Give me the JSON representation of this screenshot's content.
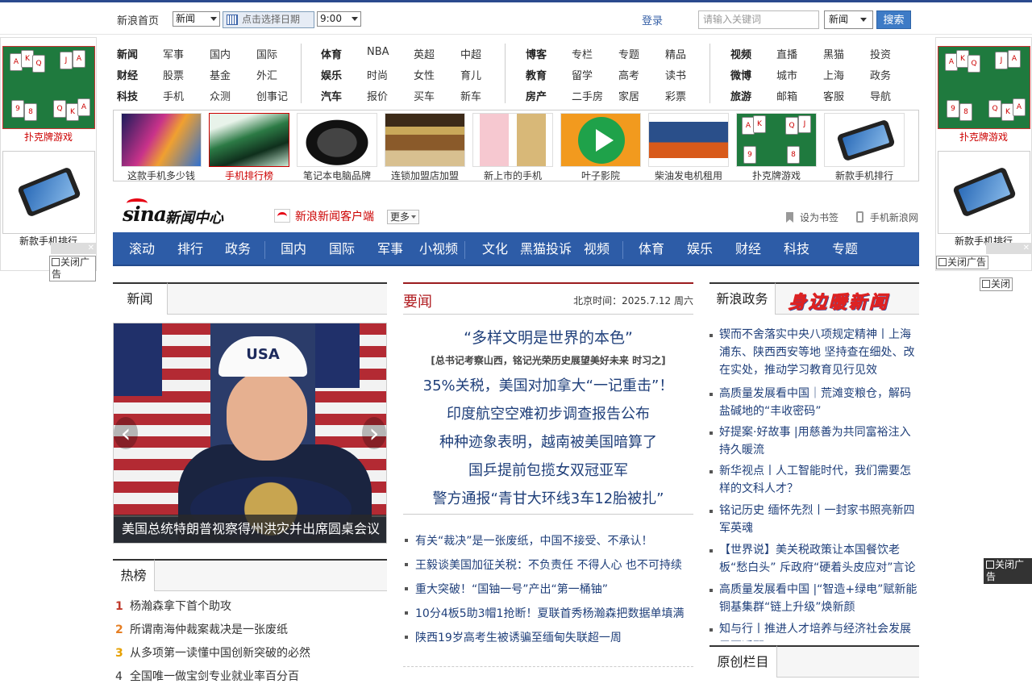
{
  "topbar": {
    "home": "新浪首页",
    "category_select": "新闻",
    "date_placeholder": "点击选择日期",
    "time_select": "9:00",
    "login": "登录",
    "search_placeholder": "请输入关键词",
    "search_scope": "新闻",
    "search_button": "搜索"
  },
  "side_ads": {
    "left_poker": "扑克牌游戏",
    "left_phone": "新款手机排行",
    "right_poker": "扑克牌游戏",
    "right_phone": "新款手机排行",
    "close_ad": "关闭广告",
    "close": "关闭"
  },
  "nav_groups": [
    {
      "rows": [
        [
          "新闻",
          "军事",
          "国内",
          "国际"
        ],
        [
          "财经",
          "股票",
          "基金",
          "外汇"
        ],
        [
          "科技",
          "手机",
          "众测",
          "创事记"
        ]
      ]
    },
    {
      "rows": [
        [
          "体育",
          "NBA",
          "英超",
          "中超"
        ],
        [
          "娱乐",
          "时尚",
          "女性",
          "育儿"
        ],
        [
          "汽车",
          "报价",
          "买车",
          "新车"
        ]
      ]
    },
    {
      "rows": [
        [
          "博客",
          "专栏",
          "专题",
          "精品"
        ],
        [
          "教育",
          "留学",
          "高考",
          "读书"
        ],
        [
          "房产",
          "二手房",
          "家居",
          "彩票"
        ]
      ]
    },
    {
      "rows": [
        [
          "视频",
          "直播",
          "黑猫",
          "投资"
        ],
        [
          "微博",
          "城市",
          "上海",
          "政务"
        ],
        [
          "旅游",
          "邮箱",
          "客服",
          "导航"
        ]
      ]
    }
  ],
  "thumbs": [
    {
      "caption": "这款手机多少钱"
    },
    {
      "caption": "手机排行榜"
    },
    {
      "caption": "笔记本电脑品牌"
    },
    {
      "caption": "连锁加盟店加盟"
    },
    {
      "caption": "新上市的手机"
    },
    {
      "caption": "叶子影院"
    },
    {
      "caption": "柴油发电机租用"
    },
    {
      "caption": "扑克牌游戏"
    },
    {
      "caption": "新款手机排行"
    }
  ],
  "brand": {
    "logo_text": "sina",
    "center": "新闻中心",
    "client": "新浪新闻客户端",
    "more": "更多",
    "bookmark": "设为书签",
    "mobile": "手机新浪网"
  },
  "main_nav": [
    "滚动",
    "排行",
    "政务",
    "国内",
    "国际",
    "军事",
    "小视频",
    "文化",
    "黑猫投诉",
    "视频",
    "体育",
    "娱乐",
    "财经",
    "科技",
    "专题"
  ],
  "left_col": {
    "tab": "新闻",
    "photo_caption": "美国总统特朗普视察得州洪灾并出席圆桌会议",
    "hot_tab": "热榜",
    "hot": [
      {
        "n": "1",
        "t": "杨瀚森拿下首个助攻",
        "color": "#c0392b"
      },
      {
        "n": "2",
        "t": "所谓南海仲裁案裁决是一张废纸",
        "color": "#e67e22"
      },
      {
        "n": "3",
        "t": "从多项第一读懂中国创新突破的必然",
        "color": "#e6a000"
      },
      {
        "n": "4",
        "t": "全国唯一做宝剑专业就业率百分百",
        "color": "#333333"
      }
    ]
  },
  "mid_col": {
    "title": "要闻",
    "time": "北京时间：2025.7.12 周六",
    "headline": "“多样文明是世界的本色”",
    "subline": "[总书记考察山西，铭记光荣历史展望美好未来 时习之]",
    "big": [
      "35%关税，美国对加拿大“一记重击”！",
      "印度航空空难初步调查报告公布",
      "种种迹象表明，越南被美国暗算了",
      "国乒提前包揽女双冠亚军",
      "警方通报“青甘大环线3车12胎被扎”"
    ],
    "list": [
      "有关“裁决”是一张废纸，中国不接受、不承认！",
      "王毅谈美国加征关税：不负责任 不得人心 也不可持续",
      "重大突破！“国铀一号”产出“第一桶铀”",
      "10分4板5助3帽1抢断！夏联首秀杨瀚森把数据单填满",
      "陕西19岁高考生被诱骗至缅甸失联超一周"
    ]
  },
  "right_col": {
    "tab": "新浪政务",
    "banner": "身边暖新闻",
    "list": [
      "锲而不舍落实中央八项规定精神丨上海浦东、陕西西安等地 坚持查在细处、改在实处，推动学习教育见行见效",
      "高质量发展看中国｜荒滩变粮仓，解码盐碱地的“丰收密码”",
      "好提案·好故事 |用慈善为共同富裕注入持久暖流",
      "新华视点丨人工智能时代，我们需要怎样的文科人才？",
      "铭记历史 缅怀先烈丨一封家书照亮新四军英魂",
      "【世界说】美关税政策让本国餐饮老板“愁白头” 斥政府“硬着头皮应对”言论",
      "高质量发展看中国 |“智造+绿电”赋新能铜基集群“链上升级”焕新颜",
      "知与行丨推进人才培养与经济社会发展需要适配"
    ],
    "orig_tab": "原创栏目"
  }
}
